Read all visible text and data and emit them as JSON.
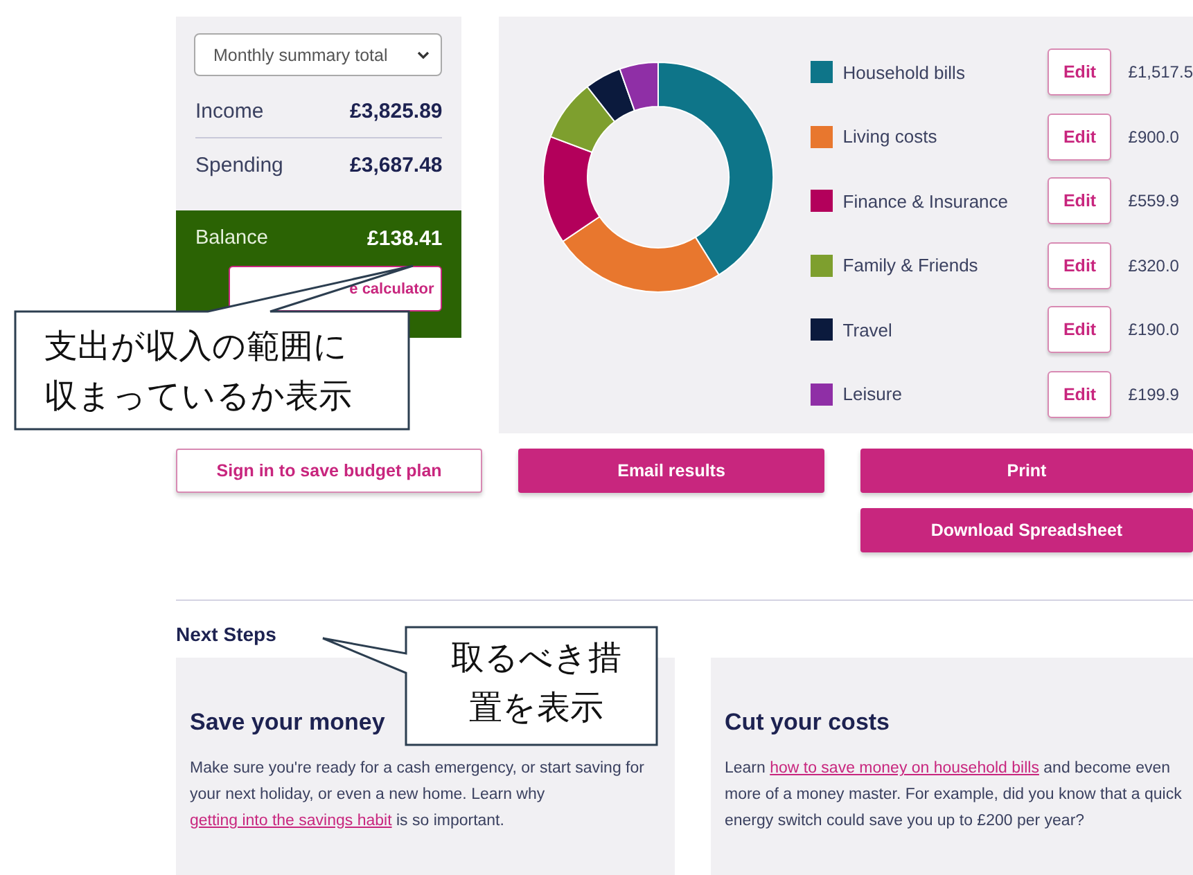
{
  "summary": {
    "period_select": "Monthly summary total",
    "rows": [
      {
        "label": "Income",
        "amount": "£3,825.89"
      },
      {
        "label": "Spending",
        "amount": "£3,687.48"
      }
    ],
    "balance": {
      "label": "Balance",
      "amount": "£138.41"
    },
    "calculator_button": "e calculator"
  },
  "breakdown": {
    "chart_data": {
      "type": "donut",
      "categories": [
        "Household bills",
        "Living costs",
        "Finance & Insurance",
        "Family & Friends",
        "Travel",
        "Leisure"
      ],
      "values": [
        41.15,
        24.41,
        15.19,
        8.68,
        5.15,
        5.42
      ]
    },
    "items": [
      {
        "color": "#0e7589",
        "edit": "Edit",
        "amount": "£1,517.5"
      },
      {
        "color": "#e8772e",
        "edit": "Edit",
        "amount": "£900.0"
      },
      {
        "color": "#b3005b",
        "edit": "Edit",
        "amount": "£559.9"
      },
      {
        "color": "#7e9f2e",
        "edit": "Edit",
        "amount": "£320.0"
      },
      {
        "color": "#0b1a3d",
        "edit": "Edit",
        "amount": "£190.0"
      },
      {
        "color": "#8f2fa6",
        "edit": "Edit",
        "amount": "£199.9"
      }
    ]
  },
  "actions": {
    "sign_in": "Sign in to save budget plan",
    "email": "Email results",
    "print": "Print",
    "download": "Download Spreadsheet"
  },
  "next_steps": {
    "heading": "Next Steps",
    "cards": [
      {
        "title": "Save your money",
        "before": "Make sure you're ready for a cash emergency, or start saving for your next holiday, or even a new home. Learn why ",
        "link": "getting into the savings habit",
        "after": " is so important."
      },
      {
        "title": "Cut your costs",
        "before": "Learn ",
        "link": "how to save money on household bills",
        "after": " and become even more of a money master. For example, did you know that a quick energy switch could save you up to £200 per year?"
      }
    ]
  },
  "callouts": [
    "支出が収入の範囲に収まっているか表示",
    "取るべき措置を表示"
  ]
}
